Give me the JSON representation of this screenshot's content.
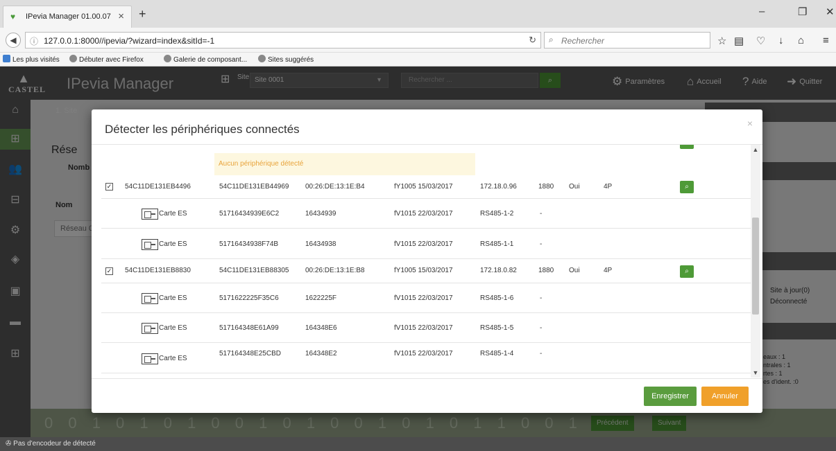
{
  "browser": {
    "tab_title": "IPevia Manager 01.00.07",
    "tab_close": "×",
    "new_tab": "+",
    "url": "127.0.0.1:8000//ipevia/?wizard=index&sitId=-1",
    "search_placeholder": "Rechercher",
    "bookmarks": [
      "Les plus visités",
      "Débuter avec Firefox",
      "Galerie de composant...",
      "Sites suggérés"
    ],
    "window_controls": [
      "–",
      "❐",
      "✕"
    ]
  },
  "app": {
    "brand": "CASTEL",
    "title": "IPevia Manager",
    "site_label": "Site",
    "site_value": "Site 0001",
    "search_placeholder": "Rechercher ...",
    "nav": {
      "settings": "Paramètres",
      "home": "Accueil",
      "help": "Aide",
      "quit": "Quitter"
    },
    "status": "Pas d'encodeur de détecté",
    "background": {
      "breadcrumb": "1. Site",
      "section": "Rése",
      "col_nomb": "Nomb",
      "col_nom": "Nom",
      "network_value": "Réseau 0",
      "site_updated": "Site à jour(0)",
      "disconnected": "Déconnecté",
      "stats": [
        "eaux :  1",
        "ntrales :  1",
        "rtes :  1",
        "es d'ident. :0"
      ],
      "prev": "Précédent",
      "next": "Suivant",
      "digits": "0 0 1 0 1 0 1 0 0 1 0 1 0 0 1 0 1 0 1 1 0 0 1 0"
    }
  },
  "modal": {
    "title": "Détecter les périphériques connectés",
    "close": "×",
    "no_device": "Aucun périphérique détecté",
    "save": "Enregistrer",
    "cancel": "Annuler",
    "rows": [
      {
        "type": "device",
        "checked": "✓",
        "name": "54C11DE131EB4496",
        "serial": "54C11DE131EB44969",
        "mac": "00:26:DE:13:1E:B4",
        "firmware": "fY1005 15/03/2017",
        "address": "172.18.0.96",
        "port": "1880",
        "active": "Oui",
        "ports": "4P"
      },
      {
        "type": "card",
        "name": "Carte ES",
        "serial": "51716434939E6C2",
        "id": "16434939",
        "firmware": "fV1015 22/03/2017",
        "address": "RS485-1-2",
        "port": "-"
      },
      {
        "type": "card",
        "name": "Carte ES",
        "serial": "51716434938F74B",
        "id": "16434938",
        "firmware": "fV1015 22/03/2017",
        "address": "RS485-1-1",
        "port": "-"
      },
      {
        "type": "device",
        "checked": "✓",
        "name": "54C11DE131EB8830",
        "serial": "54C11DE131EB88305",
        "mac": "00:26:DE:13:1E:B8",
        "firmware": "fY1005 15/03/2017",
        "address": "172.18.0.82",
        "port": "1880",
        "active": "Oui",
        "ports": "4P"
      },
      {
        "type": "card",
        "name": "Carte ES",
        "serial": "5171622225F35C6",
        "id": "1622225F",
        "firmware": "fV1015 22/03/2017",
        "address": "RS485-1-6",
        "port": "-"
      },
      {
        "type": "card",
        "name": "Carte ES",
        "serial": "517164348E61A99",
        "id": "164348E6",
        "firmware": "fV1015 22/03/2017",
        "address": "RS485-1-5",
        "port": "-"
      },
      {
        "type": "card",
        "name": "Carte ES",
        "serial": "517164348E25CBD",
        "id": "164348E2",
        "firmware": "fV1015 22/03/2017",
        "address": "RS485-1-4",
        "port": "-"
      }
    ]
  },
  "colors": {
    "accent_green": "#4e9a37",
    "cancel_orange": "#f0a02a",
    "warning_text": "#e8a33a"
  }
}
